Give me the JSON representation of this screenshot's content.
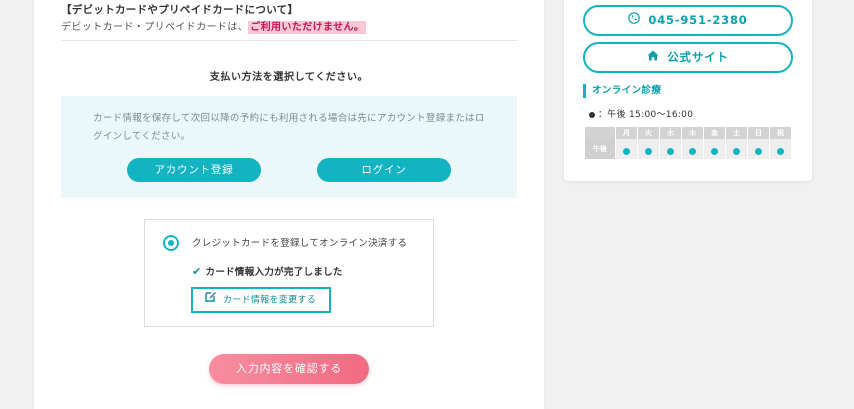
{
  "main": {
    "debit_title": "【デビットカードやプリペイドカードについて】",
    "debit_text_prefix": "デビットカード・プリペイドカードは、",
    "debit_text_highlight": "ご利用いただけません。",
    "select_heading": "支払い方法を選択してください。",
    "account_box": {
      "text": "カード情報を保存して次回以降の予約にも利用される場合は先にアカウント登録またはログインしてください。",
      "register_label": "アカウント登録",
      "login_label": "ログイン"
    },
    "card_option": {
      "radio_label": "クレジットカードを登録してオンライン決済する",
      "done_text": "カード情報入力が完了しました",
      "change_label": "カード情報を変更する"
    },
    "confirm_label": "入力内容を確認する"
  },
  "sidebar": {
    "phone": "045-951-2380",
    "site_label": "公式サイト",
    "online_heading": "オンライン診療",
    "time_text": "：午後  15:00〜16:00",
    "schedule": {
      "days": [
        "月",
        "火",
        "水",
        "木",
        "金",
        "土",
        "日",
        "祝"
      ],
      "row_label": "午後",
      "available": [
        true,
        true,
        true,
        true,
        true,
        true,
        true,
        true
      ]
    }
  },
  "colors": {
    "accent": "#14b3c2",
    "confirm": "#f26a82",
    "highlight": "#f9c8d2"
  }
}
